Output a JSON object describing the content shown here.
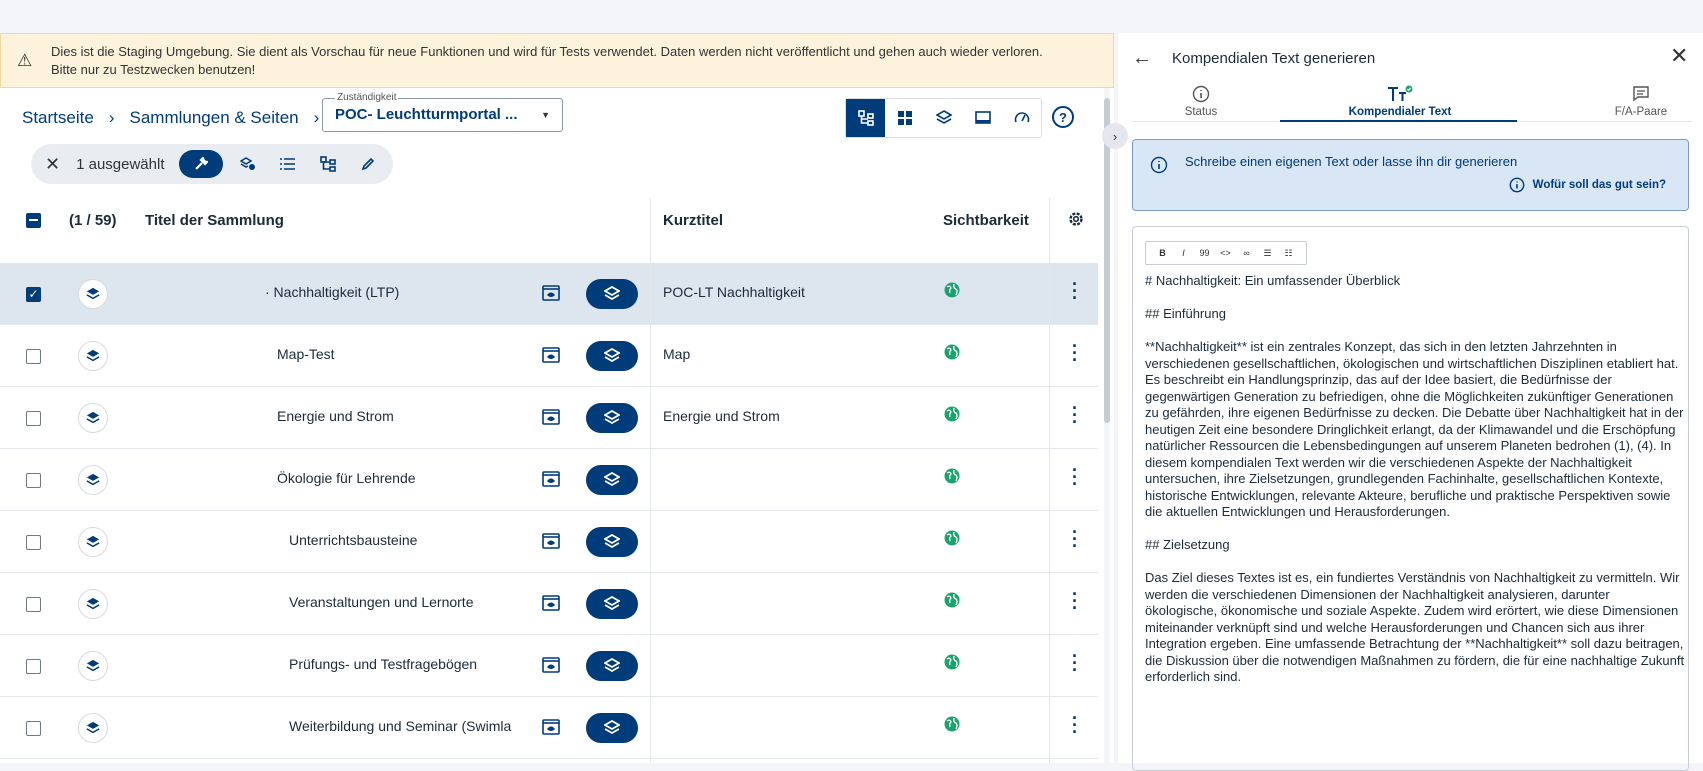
{
  "banner": {
    "line1": "Dies ist die Staging Umgebung. Sie dient als Vorschau für neue Funktionen und wird für Tests verwendet. Daten werden nicht veröffentlicht und gehen auch wieder verloren.",
    "line2": "Bitte nur zu Testzwecken benutzen!"
  },
  "breadcrumb": {
    "home": "Startseite",
    "collections": "Sammlungen & Seiten"
  },
  "zustaendigkeit": {
    "label": "Zuständigkeit",
    "value": "POC- Leuchtturmportal ..."
  },
  "selection": {
    "count_label": "1 ausgewählt"
  },
  "table": {
    "count": "(1 / 59)",
    "col_title": "Titel der Sammlung",
    "col_short": "Kurztitel",
    "col_visibility": "Sichtbarkeit",
    "rows": [
      {
        "title": "· Nachhaltigkeit (LTP)",
        "short": "POC-LT Nachhaltigkeit",
        "checked": true
      },
      {
        "title": "Map-Test",
        "short": "Map",
        "checked": false
      },
      {
        "title": "Energie und Strom",
        "short": "Energie und Strom",
        "checked": false
      },
      {
        "title": "Ökologie für Lehrende",
        "short": "",
        "checked": false
      },
      {
        "title": "Unterrichtsbausteine",
        "short": "",
        "checked": false
      },
      {
        "title": "Veranstaltungen und Lernorte",
        "short": "",
        "checked": false
      },
      {
        "title": "Prüfungs- und Testfragebögen",
        "short": "",
        "checked": false
      },
      {
        "title": "Weiterbildung und Seminar (Swimla",
        "short": "",
        "checked": false
      }
    ]
  },
  "panel": {
    "title": "Kompendialen Text generieren",
    "tabs": [
      {
        "label": "Status",
        "icon": "info-icon"
      },
      {
        "label": "Kompendialer Text",
        "icon": "text-check-icon"
      },
      {
        "label": "F/A-Paare",
        "icon": "chat-icon"
      }
    ],
    "info_text": "Schreibe einen eigenen Text oder lasse ihn dir generieren",
    "info_link": "Wofür soll das gut sein?",
    "toolbar": [
      "B",
      "I",
      "99",
      "<>",
      "∞",
      "☰",
      "☷"
    ],
    "editor": {
      "h1": "# Nachhaltigkeit: Ein umfassender Überblick",
      "h2a": "## Einführung",
      "p1": "**Nachhaltigkeit** ist ein zentrales Konzept, das sich in den letzten Jahrzehnten in verschiedenen gesellschaftlichen, ökologischen und wirtschaftlichen Disziplinen etabliert hat. Es beschreibt ein Handlungsprinzip, das auf der Idee basiert, die Bedürfnisse der gegenwärtigen Generation zu befriedigen, ohne die Möglichkeiten zukünftiger Generationen zu gefährden, ihre eigenen Bedürfnisse zu decken. Die Debatte über Nachhaltigkeit hat in der heutigen Zeit eine besondere Dringlichkeit erlangt, da der Klimawandel und die Erschöpfung natürlicher Ressourcen die Lebensbedingungen auf unserem Planeten bedrohen (1), (4). In diesem kompendialen Text werden wir die verschiedenen Aspekte der Nachhaltigkeit untersuchen, ihre Zielsetzungen, grundlegenden Fachinhalte, gesellschaftlichen Kontexte, historische Entwicklungen, relevante Akteure, berufliche und praktische Perspektiven sowie die aktuellen Entwicklungen und Herausforderungen.",
      "h2b": "## Zielsetzung",
      "p2": "Das Ziel dieses Textes ist es, ein fundiertes Verständnis von Nachhaltigkeit zu vermitteln. Wir werden die verschiedenen Dimensionen der Nachhaltigkeit analysieren, darunter ökologische, ökonomische und soziale Aspekte. Zudem wird erörtert, wie diese Dimensionen miteinander verknüpft sind und welche Herausforderungen und Chancen sich aus ihrer Integration ergeben. Eine umfassende Betrachtung der **Nachhaltigkeit** soll dazu beitragen, die Diskussion über die notwendigen Maßnahmen zu fördern, die für eine nachhaltige Zukunft erforderlich sind."
    }
  }
}
